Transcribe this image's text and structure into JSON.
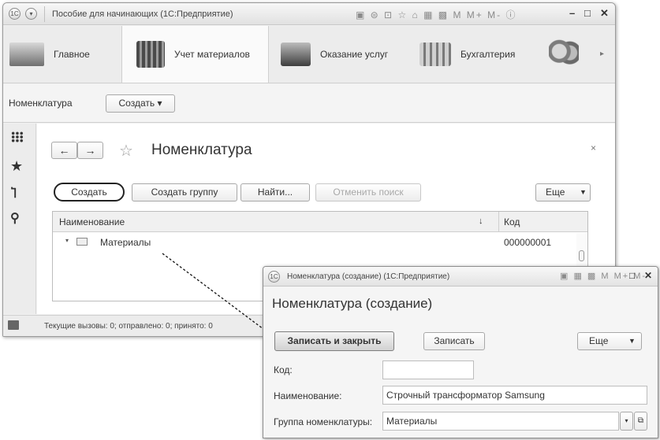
{
  "main": {
    "title": "Пособие для начинающих  (1С:Предприятие)",
    "toolbar_icons": "▣ ⊜ ⊡ ☆ ⌂ ▦ ▩  M M+ M-  ⓘ",
    "sections": [
      "Главное",
      "Учет материалов",
      "Оказание услуг",
      "Бухгалтерия"
    ],
    "nav": {
      "title": "Номенклатура",
      "create": "Создать ▾"
    },
    "form": {
      "title": "Номенклатура",
      "buttons": {
        "create": "Создать",
        "create_group": "Создать группу",
        "find": "Найти...",
        "cancel_search": "Отменить поиск",
        "more": "Еще"
      },
      "columns": {
        "name": "Наименование",
        "sort": "↓",
        "code": "Код"
      },
      "rows": [
        {
          "name": "Материалы",
          "code": "000000001"
        }
      ]
    },
    "status": "Текущие вызовы: 0; отправлено: 0; принято: 0"
  },
  "dialog": {
    "title": "Номенклатура (создание)  (1С:Предприятие)",
    "heading": "Номенклатура (создание)",
    "buttons": {
      "save_close": "Записать и закрыть",
      "save": "Записать",
      "more": "Еще"
    },
    "fields": {
      "code_label": "Код:",
      "code_value": "",
      "name_label": "Наименование:",
      "name_value": "Строчный трансформатор Samsung",
      "group_label": "Группа номенклатуры:",
      "group_value": "Материалы"
    }
  },
  "colors": {
    "accent": "#f3c400"
  }
}
